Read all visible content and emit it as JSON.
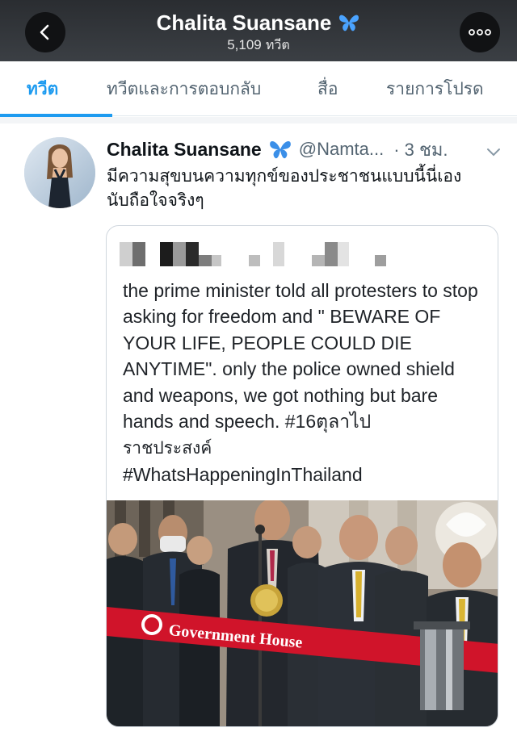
{
  "header": {
    "back_icon": "chevron-left-icon",
    "title": "Chalita Suansane",
    "verified_icon": "blue-butterfly-icon",
    "tweet_count_num": "5,109",
    "tweet_count_unit": "ทวีต",
    "more_icon": "ellipsis-icon"
  },
  "tabs": [
    {
      "label": "ทวีต",
      "active": true
    },
    {
      "label": "ทวีตและการตอบกลับ",
      "active": false
    },
    {
      "label": "สื่อ",
      "active": false
    },
    {
      "label": "รายการโปรด",
      "active": false
    }
  ],
  "tweet": {
    "author_name": "Chalita Suansane",
    "handle": "@Namta...",
    "time": "· 3 ชม.",
    "text_line1": "มีความสุขบนความทุกข์ของประชาชนแบบนี้นี่เอง",
    "text_line2": "นับถือใจจริงๆ"
  },
  "quote": {
    "text_en": "the prime minister told all protesters to stop asking for freedom and \" BEWARE OF YOUR LIFE, PEOPLE COULD DIE ANYTIME\". only the police owned shield and weapons, we got nothing but bare hands and speech.  #16ตุลาไป",
    "text_th": "ราชประสงค์",
    "hashtag": "#WhatsHappeningInThailand",
    "photo_banner_text": "Government House"
  },
  "colors": {
    "accent": "#1d9bf0",
    "header_bg": "#33373b",
    "banner_red": "#d0142a"
  }
}
